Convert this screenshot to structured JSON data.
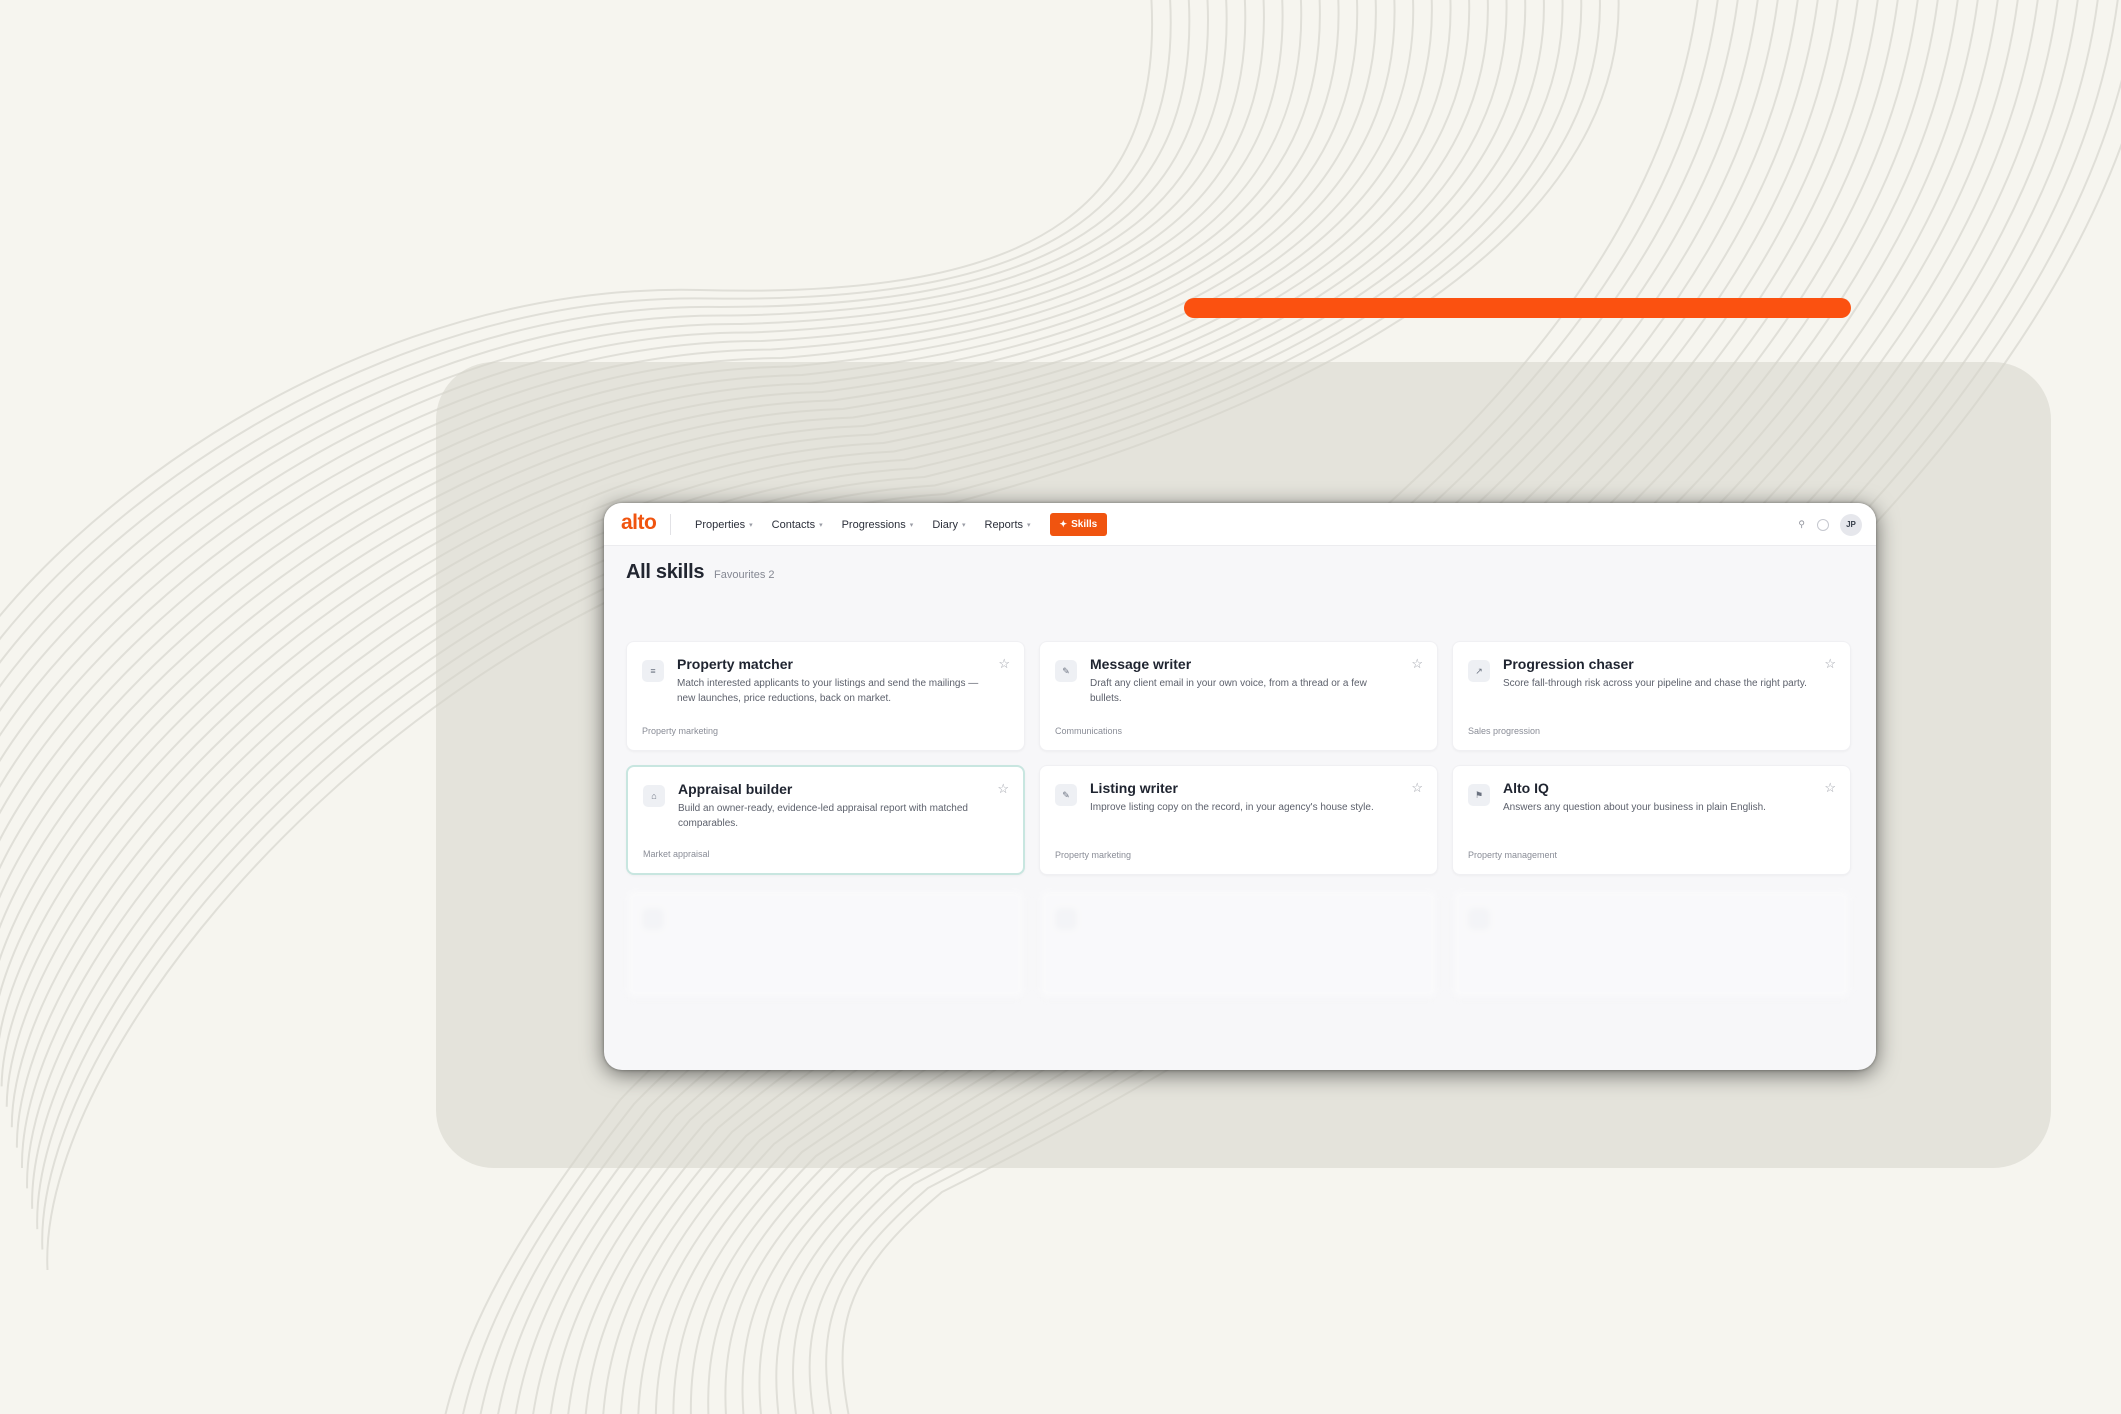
{
  "app": {
    "logo": "alto",
    "nav": [
      {
        "label": "Properties"
      },
      {
        "label": "Contacts"
      },
      {
        "label": "Progressions"
      },
      {
        "label": "Diary"
      },
      {
        "label": "Reports"
      }
    ],
    "skills_button": "Skills",
    "user_initials": "JP"
  },
  "page": {
    "title": "All skills",
    "subtitle": "Favourites 2"
  },
  "cards": [
    {
      "title": "Property matcher",
      "description": "Match interested applicants to your listings and send the mailings — new launches, price reductions, back on market.",
      "category": "Property marketing",
      "icon": "list-icon",
      "glyph": "≡"
    },
    {
      "title": "Message writer",
      "description": "Draft any client email in your own voice, from a thread or a few bullets.",
      "category": "Communications",
      "icon": "pencil-icon",
      "glyph": "✎"
    },
    {
      "title": "Progression chaser",
      "description": "Score fall-through risk across your pipeline and chase the right party.",
      "category": "Sales progression",
      "icon": "arrow-icon",
      "glyph": "↗"
    },
    {
      "title": "Appraisal builder",
      "description": "Build an owner-ready, evidence-led appraisal report with matched comparables.",
      "category": "Market appraisal",
      "icon": "home-icon",
      "glyph": "⌂"
    },
    {
      "title": "Listing writer",
      "description": "Improve listing copy on the record, in your agency's house style.",
      "category": "Property marketing",
      "icon": "pencil-icon",
      "glyph": "✎"
    },
    {
      "title": "Alto IQ",
      "description": "Answers any question about your business in plain English.",
      "category": "Property management",
      "icon": "chat-icon",
      "glyph": "⚑"
    }
  ],
  "colors": {
    "brand": "#f0540f",
    "accent_bar": "#fb5110",
    "background": "#f6f5ef",
    "selected_border": "#c8e6e0"
  }
}
